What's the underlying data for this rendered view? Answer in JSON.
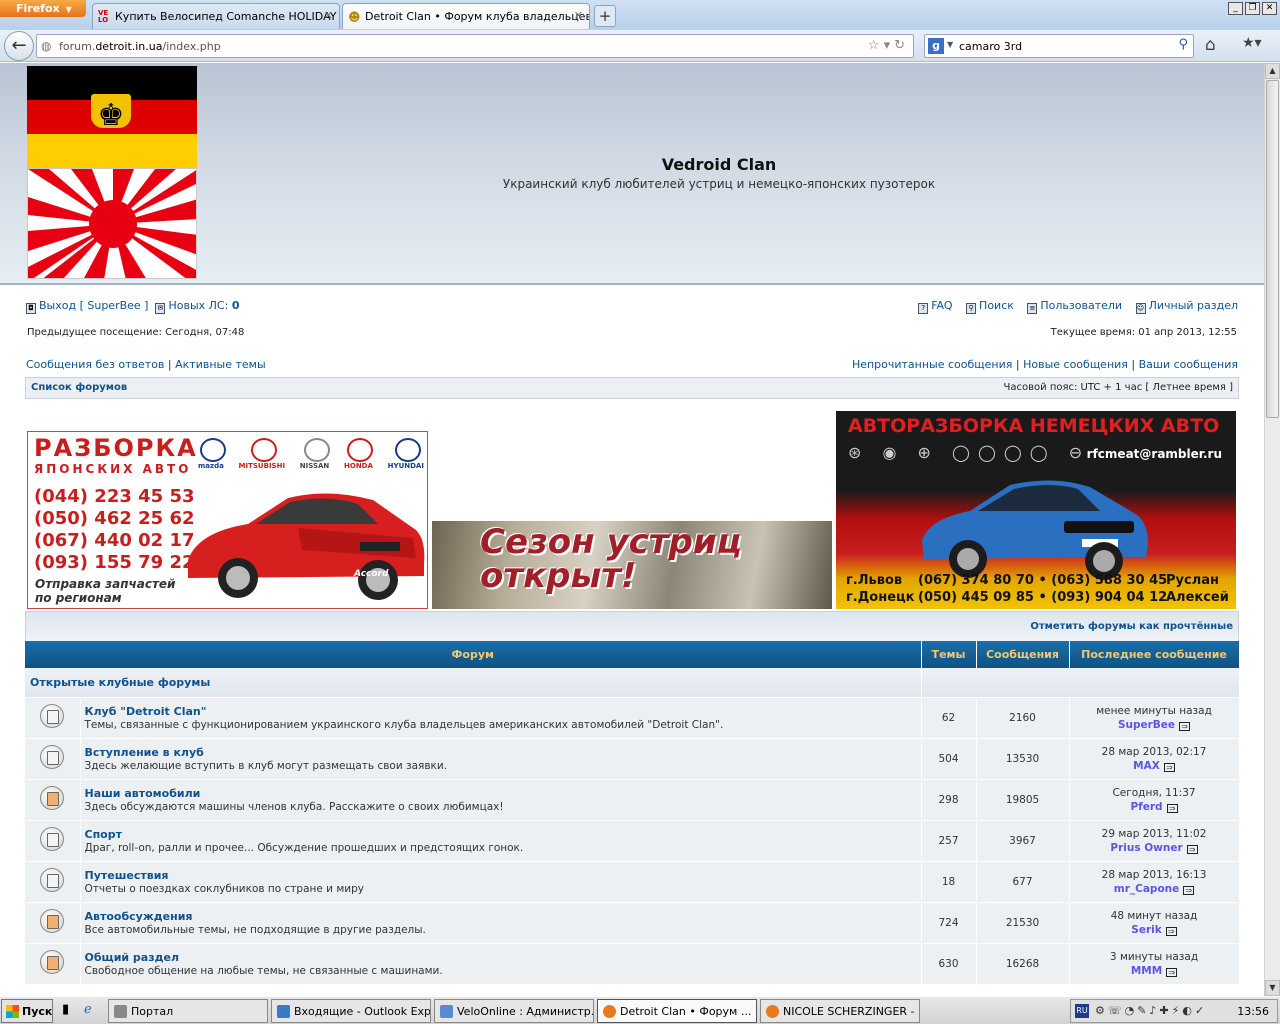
{
  "browser": {
    "app_button": "Firefox",
    "tabs": [
      {
        "label": "Купить Велосипед Comanche HOLIDAY ..."
      },
      {
        "label": "Detroit Clan • Форум клуба владельцев..."
      }
    ],
    "url_host_prefix": "forum.",
    "url_host": "detroit.in.ua",
    "url_path": "/index.php",
    "search_value": "camaro 3rd",
    "search_engine": "Google"
  },
  "site": {
    "title": "Vedroid Clan",
    "description": "Украинский клуб любителей устриц и немецко-японских пузотерок"
  },
  "userbar": {
    "logout_label": "Выход [ SuperBee ]",
    "pm_label": "Новых ЛС:",
    "pm_count": "0",
    "faq": "FAQ",
    "search": "Поиск",
    "members": "Пользователи",
    "ucp": "Личный раздел",
    "last_visit": "Предыдущее посещение: Сегодня, 07:48",
    "current_time": "Текущее время: 01 апр 2013, 12:55"
  },
  "searchlinks": {
    "unanswered": "Сообщения без ответов",
    "active": "Активные темы",
    "unread": "Непрочитанные сообщения",
    "new_posts": "Новые сообщения",
    "your_posts": "Ваши сообщения"
  },
  "breadcrumb": {
    "index": "Список форумов",
    "timezone": "Часовой пояс: UTC + 1 час [ Летнее время ]"
  },
  "ads": {
    "jp": {
      "title": "РАЗБОРКА",
      "subtitle": "ЯПОНСКИХ АВТО",
      "brands": [
        "mazda",
        "MITSUBISHI",
        "NISSAN",
        "HONDA",
        "HYUNDAI"
      ],
      "phones": [
        "(044) 223 45 53",
        "(050) 462 25 62",
        "(067) 440 02 17",
        "(093) 155 79 22"
      ],
      "shipping_line1": "Отправка запчастей",
      "shipping_line2": "по регионам",
      "car_model": "Accord"
    },
    "oyster": {
      "line1": "Сезон устриц",
      "line2": "открыт!"
    },
    "de": {
      "title": "АВТОРАЗБОРКА НЕМЕЦКИХ АВТО",
      "email": "rfcmeat@rambler.ru",
      "rows": [
        {
          "city": "г.Львов",
          "phones": "(067) 374 80 70  •  (063) 588 30 45",
          "name": "Руслан"
        },
        {
          "city": "г.Донецк",
          "phones": "(050) 445 09 85  •  (093) 904 04 12",
          "name": "Алексей"
        }
      ]
    }
  },
  "forum": {
    "mark_read": "Отметить форумы как прочтённые",
    "headers": {
      "forum": "Форум",
      "topics": "Темы",
      "posts": "Сообщения",
      "last_post": "Последнее сообщение"
    },
    "category": "Открытые клубные форумы",
    "rows": [
      {
        "name": "Клуб \"Detroit Clan\"",
        "desc": "Темы, связанные с функционированием украинского клуба владельцев американских автомобилей \"Detroit Clan\".",
        "topics": "62",
        "posts": "2160",
        "last_time": "менее минуты назад",
        "last_user": "SuperBee",
        "hot": false
      },
      {
        "name": "Вступление в клуб",
        "desc": "Здесь желающие вступить в клуб могут размещать свои заявки.",
        "topics": "504",
        "posts": "13530",
        "last_time": "28 мар 2013, 02:17",
        "last_user": "MAX",
        "hot": false
      },
      {
        "name": "Наши автомобили",
        "desc": "Здесь обсуждаются машины членов клуба. Расскажите о своих любимцах!",
        "topics": "298",
        "posts": "19805",
        "last_time": "Сегодня, 11:37",
        "last_user": "Pferd",
        "hot": true
      },
      {
        "name": "Спорт",
        "desc": "Драг, roll-on, ралли и прочее... Обсуждение прошедших и предстоящих гонок.",
        "topics": "257",
        "posts": "3967",
        "last_time": "29 мар 2013, 11:02",
        "last_user": "Prius Owner",
        "hot": false
      },
      {
        "name": "Путешествия",
        "desc": "Отчеты о поездках соклубников по стране и миру",
        "topics": "18",
        "posts": "677",
        "last_time": "28 мар 2013, 16:13",
        "last_user": "mr_Capone",
        "hot": false
      },
      {
        "name": "Автообсуждения",
        "desc": "Все автомобильные темы, не подходящие в другие разделы.",
        "topics": "724",
        "posts": "21530",
        "last_time": "48 минут назад",
        "last_user": "Serik",
        "hot": true
      },
      {
        "name": "Общий раздел",
        "desc": "Свободное общение на любые темы, не связанные с машинами.",
        "topics": "630",
        "posts": "16268",
        "last_time": "3 минуты назад",
        "last_user": "MMM",
        "hot": true
      }
    ]
  },
  "taskbar": {
    "start": "Пуск",
    "tasks": [
      {
        "label": "Портал"
      },
      {
        "label": "Входящие - Outlook Exp..."
      },
      {
        "label": "VeloOnline : Администр..."
      },
      {
        "label": "Detroit Clan • Форум ..."
      },
      {
        "label": "NICOLE SCHERZINGER - ..."
      }
    ],
    "lang": "RU",
    "clock": "13:56"
  }
}
